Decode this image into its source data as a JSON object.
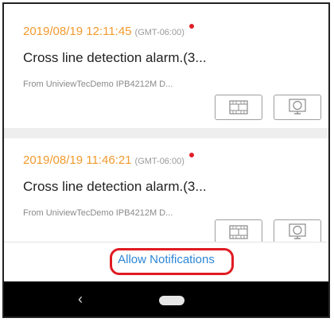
{
  "notifications": [
    {
      "timestamp": "2019/08/19 12:11:45",
      "timezone": "(GMT-06:00)",
      "title": "Cross line detection alarm.(3...",
      "source": "From UniviewTecDemo IPB4212M D...",
      "unread": true
    },
    {
      "timestamp": "2019/08/19 11:46:21",
      "timezone": "(GMT-06:00)",
      "title": "Cross line detection alarm.(3...",
      "source": "From UniviewTecDemo IPB4212M D...",
      "unread": true
    }
  ],
  "actions": {
    "video_icon": "film-strip-icon",
    "live_icon": "monitor-icon"
  },
  "bottom": {
    "allow_label": "Allow Notifications"
  },
  "colors": {
    "timestamp": "#f29a2e",
    "unread_dot": "#e0202a",
    "link": "#2d86d6",
    "highlight": "#e01b22"
  },
  "navbar": {
    "back_icon": "back-chevron-icon",
    "home_icon": "home-pill-icon"
  }
}
